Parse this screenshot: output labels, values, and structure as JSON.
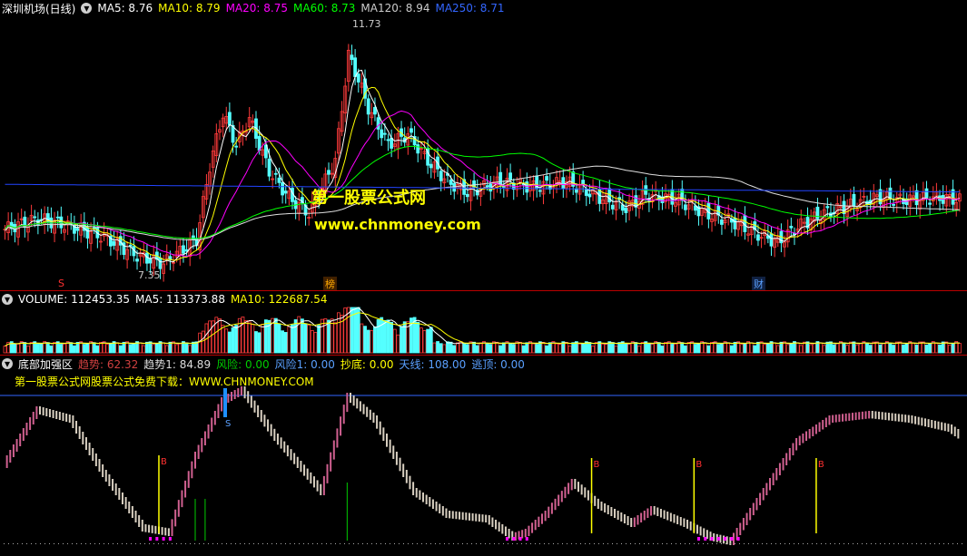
{
  "price_panel": {
    "title": "深圳机场(日线)",
    "indicators": [
      {
        "label": "MA5: 8.76",
        "color": "#ffffff"
      },
      {
        "label": "MA10: 8.79",
        "color": "#ffff00"
      },
      {
        "label": "MA20: 8.75",
        "color": "#ff00ff"
      },
      {
        "label": "MA60: 8.73",
        "color": "#00ff00"
      },
      {
        "label": "MA120: 8.94",
        "color": "#cccccc"
      },
      {
        "label": "MA250: 8.71",
        "color": "#3366ff"
      }
    ],
    "high_label": "11.73",
    "low_label": "7.35",
    "markers": [
      {
        "text": "S",
        "color": "#ff3030"
      },
      {
        "text": "榜",
        "color": "#ffaa00"
      },
      {
        "text": "财",
        "color": "#5aa0ff"
      }
    ],
    "watermark_cn": "第一股票公式网",
    "watermark_url": "www.chnmoney.com"
  },
  "volume_panel": {
    "title": "VOLUME: 112453.35",
    "ma5": "MA5: 113373.88",
    "ma10": "MA10: 122687.54"
  },
  "indicator_panel": {
    "title": "底部加强区",
    "values": [
      {
        "label": "趋势: 62.32",
        "color": "#d04040"
      },
      {
        "label": "趋势1: 84.89",
        "color": "#dddddd"
      },
      {
        "label": "风险: 0.00",
        "color": "#00cc00"
      },
      {
        "label": "风险1: 0.00",
        "color": "#5aa0ff"
      },
      {
        "label": "抄底: 0.00",
        "color": "#ffff00"
      },
      {
        "label": "天线: 108.00",
        "color": "#5aa0ff"
      },
      {
        "label": "逃顶: 0.00",
        "color": "#5aa0ff"
      }
    ],
    "download_text": "第一股票公式网股票公式免费下载：WWW.CHNMONEY.COM",
    "b_label": "B",
    "s_label": "S"
  }
}
